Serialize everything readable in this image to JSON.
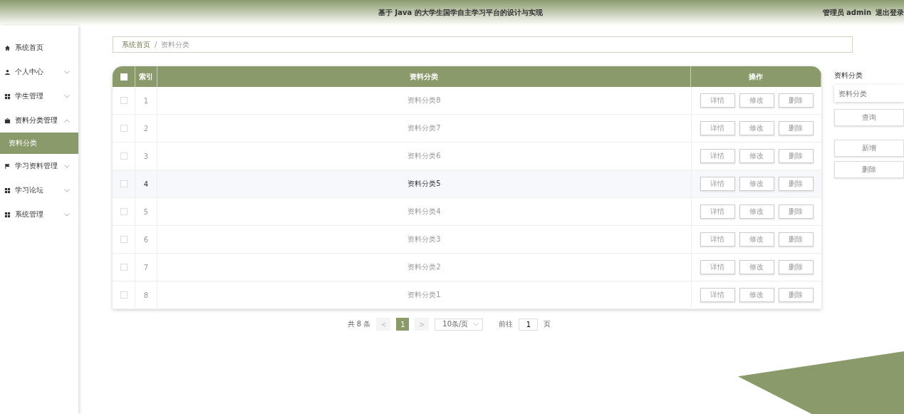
{
  "header": {
    "title": "基于 Java 的大学生国学自主学习平台的设计与实现",
    "user": "管理员 admin",
    "logout": "退出登录"
  },
  "sidebar": {
    "items": [
      {
        "label": "系统首页",
        "kind": "home"
      },
      {
        "label": "个人中心",
        "kind": "user",
        "expanded": false
      },
      {
        "label": "学生管理",
        "kind": "grid",
        "expanded": false
      },
      {
        "label": "资料分类管理",
        "kind": "case",
        "expanded": true,
        "children": [
          {
            "label": "资料分类",
            "selected": true
          }
        ]
      },
      {
        "label": "学习资料管理",
        "kind": "flag",
        "expanded": false
      },
      {
        "label": "学习论坛",
        "kind": "grid",
        "expanded": false
      },
      {
        "label": "系统管理",
        "kind": "grid",
        "expanded": false
      }
    ]
  },
  "breadcrumb": {
    "items": [
      "系统首页",
      "资料分类"
    ],
    "separator": "/"
  },
  "table": {
    "columns": [
      "索引",
      "资料分类",
      "操作"
    ],
    "checked_all": false,
    "rows": [
      {
        "index": "1",
        "name": "资料分类8",
        "checked": false,
        "hovered": false,
        "actions": [
          "详情",
          "修改",
          "删除"
        ]
      },
      {
        "index": "2",
        "name": "资料分类7",
        "checked": false,
        "hovered": false,
        "actions": [
          "详情",
          "修改",
          "删除"
        ]
      },
      {
        "index": "3",
        "name": "资料分类6",
        "checked": false,
        "hovered": false,
        "actions": [
          "详情",
          "修改",
          "删除"
        ]
      },
      {
        "index": "4",
        "name": "资料分类5",
        "checked": false,
        "hovered": true,
        "actions": [
          "详情",
          "修改",
          "删除"
        ]
      },
      {
        "index": "5",
        "name": "资料分类4",
        "checked": false,
        "hovered": false,
        "actions": [
          "详情",
          "修改",
          "删除"
        ]
      },
      {
        "index": "6",
        "name": "资料分类3",
        "checked": false,
        "hovered": false,
        "actions": [
          "详情",
          "修改",
          "删除"
        ]
      },
      {
        "index": "7",
        "name": "资料分类2",
        "checked": false,
        "hovered": false,
        "actions": [
          "详情",
          "修改",
          "删除"
        ]
      },
      {
        "index": "8",
        "name": "资料分类1",
        "checked": false,
        "hovered": false,
        "actions": [
          "详情",
          "修改",
          "删除"
        ]
      }
    ]
  },
  "pagination": {
    "total": "共 8 条",
    "prev": "<",
    "pages": [
      {
        "label": "1",
        "selected": true
      }
    ],
    "next": ">",
    "page_size": "10条/页",
    "goto": "前往",
    "goto_value": "1",
    "page_unit": "页"
  },
  "search_panel": {
    "label": "资料分类",
    "placeholder": "资料分类",
    "search": "查询",
    "add": "新增",
    "delete": "删除"
  }
}
